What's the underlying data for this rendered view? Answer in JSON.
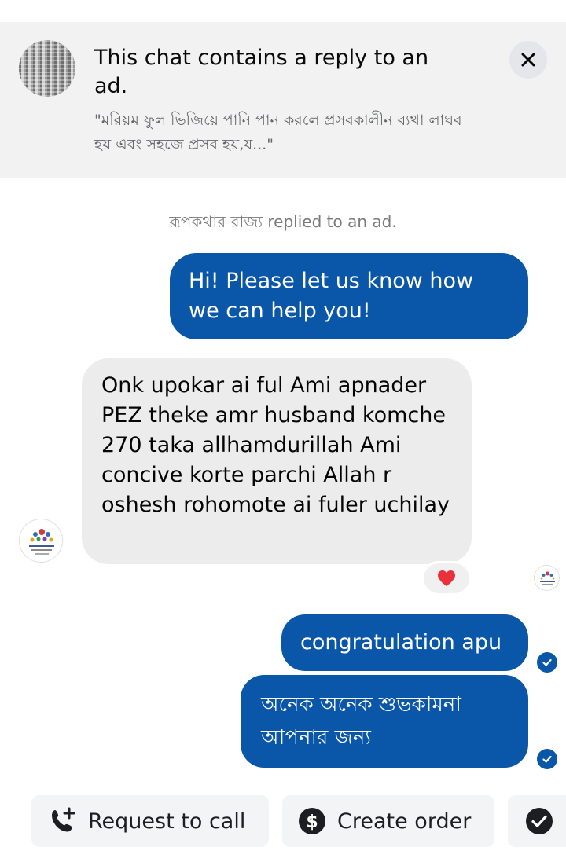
{
  "banner": {
    "title": "This chat contains a reply to an ad.",
    "quote": "\"মরিয়ম ফুল ভিজিয়ে পানি পান করলে প্রসবকালীন ব্যথা লাঘব হয় এবং সহজে প্রসব হয়,য...\"",
    "close_icon": "close-icon"
  },
  "system_note": "রূপকথার রাজ্য replied to an ad.",
  "messages": [
    {
      "direction": "outgoing",
      "text": "Hi! Please let us know how we can help you!"
    },
    {
      "direction": "incoming",
      "text": "Onk upokar ai ful Ami apnader PEZ theke amr husband komche 270 taka allhamdurillah Ami concive korte parchi Allah r oshesh rohomote ai fuler uchilay",
      "reaction": "heart-icon"
    },
    {
      "direction": "outgoing",
      "text": "congratulation apu",
      "status": "read"
    },
    {
      "direction": "outgoing",
      "text": "অনেক অনেক শুভকামনা আপনার জন্য",
      "status": "read"
    }
  ],
  "actions": [
    {
      "label": "Request to call",
      "icon": "phone-add-icon"
    },
    {
      "label": "Create order",
      "icon": "dollar-icon"
    },
    {
      "label": "",
      "icon": "check-circle-icon"
    }
  ],
  "colors": {
    "outgoing_bubble": "#0a56a8",
    "incoming_bubble": "#ececec",
    "banner_bg": "#f2f2f2"
  }
}
